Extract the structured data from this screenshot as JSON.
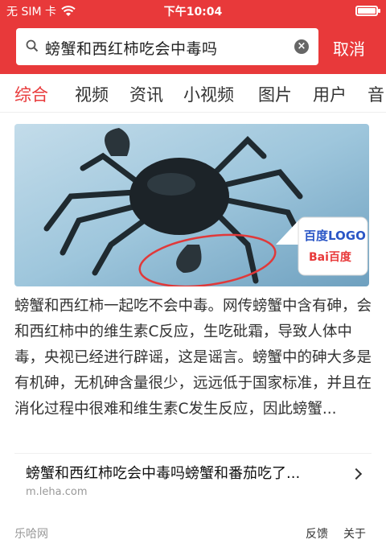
{
  "status_bar": {
    "carrier": "无 SIM 卡",
    "time": "下午10:04"
  },
  "search": {
    "query": "螃蟹和西红柿吃会中毒吗",
    "cancel_label": "取消"
  },
  "tabs": [
    {
      "label": "综合",
      "active": true
    },
    {
      "label": "视频"
    },
    {
      "label": "资讯"
    },
    {
      "label": "小视频"
    },
    {
      "label": "图片"
    },
    {
      "label": "用户"
    },
    {
      "label": "音"
    }
  ],
  "result": {
    "image_badge_line1": "百度LOGO",
    "image_badge_logo": "Bai百度",
    "description": "螃蟹和西红柿一起吃不会中毒。网传螃蟹中含有砷，会和西红柿中的维生素C反应，生吃砒霜，导致人体中毒，央视已经进行辟谣，这是谣言。螃蟹中的砷大多是有机砷，无机砷含量很少，远远低于国家标准，并且在消化过程中很难和维生素C发生反应，因此螃蟹...",
    "related_title": "螃蟹和西红柿吃会中毒吗螃蟹和番茄吃了...",
    "related_domain": "m.leha.com"
  },
  "footer": {
    "source": "乐哈网",
    "feedback": "反馈",
    "about": "关于"
  },
  "colors": {
    "accent": "#e8393a"
  }
}
